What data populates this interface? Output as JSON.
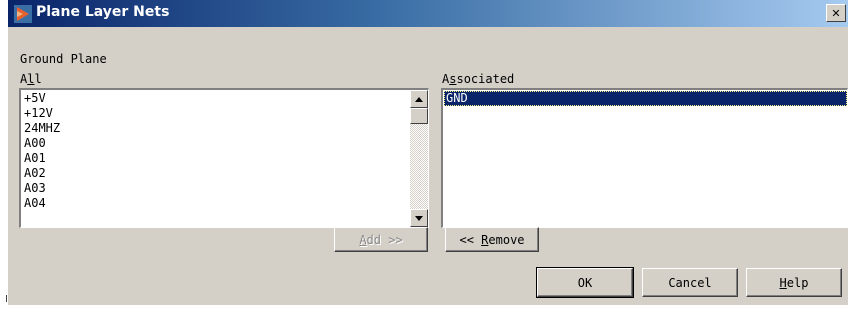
{
  "window": {
    "title": "Plane Layer Nets",
    "close_glyph": "✕"
  },
  "section": {
    "plane_label": "Ground Plane"
  },
  "all_list": {
    "label_prefix": "A",
    "label_mnemonic": "l",
    "label_rest": "l",
    "items": [
      "+5V",
      "+12V",
      "24MHZ",
      "A00",
      "A01",
      "A02",
      "A03",
      "A04"
    ]
  },
  "associated_list": {
    "label_prefix": "A",
    "label_mnemonic": "s",
    "label_rest": "sociated",
    "items": [
      "GND"
    ],
    "selected_index": 0
  },
  "buttons": {
    "add_mnemonic": "A",
    "add_rest": "dd >>",
    "remove_prefix": "<< ",
    "remove_mnemonic": "R",
    "remove_rest": "emove",
    "ok": "OK",
    "cancel": "Cancel",
    "help_mnemonic": "H",
    "help_rest": "elp"
  },
  "icons": {
    "app_icon": "pads-logo-icon",
    "scroll_up": "triangle-up-icon",
    "scroll_down": "triangle-down-icon"
  },
  "colors": {
    "title_gradient_start": "#0a246a",
    "title_gradient_end": "#a6caf0",
    "selection": "#0a246a",
    "dialog_face": "#d4d0c8"
  }
}
